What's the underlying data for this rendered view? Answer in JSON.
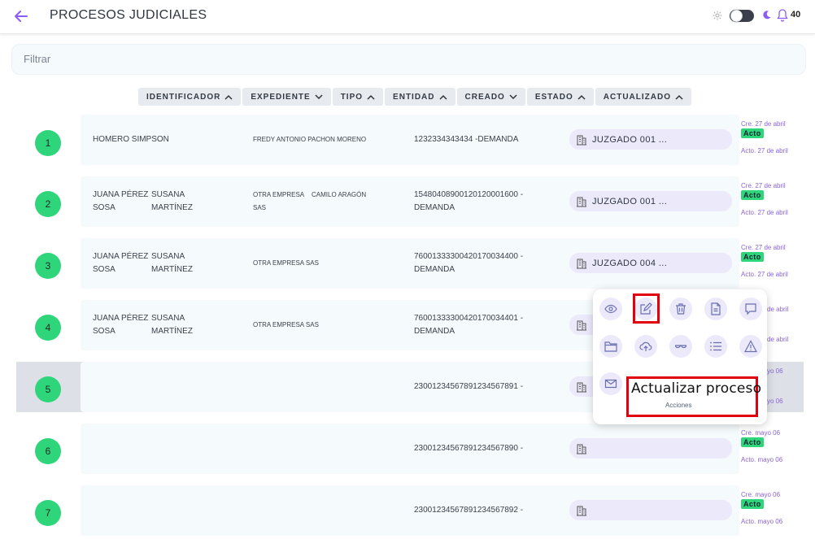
{
  "header": {
    "title": "PROCESOS JUDICIALES",
    "notification_count": "40",
    "accent": "#8b5cf6"
  },
  "filter": {
    "placeholder": "Filtrar"
  },
  "sort_columns": [
    {
      "label": "IDENTIFICADOR",
      "dir": "up"
    },
    {
      "label": "EXPEDIENTE",
      "dir": "down"
    },
    {
      "label": "TIPO",
      "dir": "up"
    },
    {
      "label": "ENTIDAD",
      "dir": "up"
    },
    {
      "label": "CREADO",
      "dir": "down"
    },
    {
      "label": "ESTADO",
      "dir": "up"
    },
    {
      "label": "ACTUALIZADO",
      "dir": "up"
    }
  ],
  "rows": [
    {
      "num": "1",
      "name_a": "HOMERO SIMPSON",
      "name_b": "",
      "name_c": "",
      "name_d": "",
      "exp_a": "FREDY ANTONIO PACHON MORENO",
      "exp_b": "",
      "exp_c": "",
      "id_line1": "1232334343434 -DEMANDA",
      "id_line2": "",
      "entity": "JUZGADO 001 ...",
      "created": "Cre. 27 de abril",
      "status": "Acto",
      "updated": "Acto. 27 de abril"
    },
    {
      "num": "2",
      "name_a": "JUANA PÉREZ",
      "name_b": "SUSANA",
      "name_c": "SOSA",
      "name_d": "MARTÍNEZ",
      "exp_a": "OTRA EMPRESA",
      "exp_b": "CAMILO ARAGÓN",
      "exp_c": "SAS",
      "id_line1": "15480408900120120001600 -",
      "id_line2": "DEMANDA",
      "entity": "JUZGADO 001 ...",
      "created": "Cre. 27 de abril",
      "status": "Acto",
      "updated": "Acto. 27 de abril"
    },
    {
      "num": "3",
      "name_a": "JUANA PÉREZ",
      "name_b": "SUSANA",
      "name_c": "SOSA",
      "name_d": "MARTÍNEZ",
      "exp_a": "OTRA EMPRESA SAS",
      "exp_b": "",
      "exp_c": "",
      "id_line1": "76001333300420170034400 -",
      "id_line2": "DEMANDA",
      "entity": "JUZGADO 004 ...",
      "created": "Cre. 27 de abril",
      "status": "Acto",
      "updated": "Acto. 27 de abril"
    },
    {
      "num": "4",
      "name_a": "JUANA PÉREZ",
      "name_b": "SUSANA",
      "name_c": "SOSA",
      "name_d": "MARTÍNEZ",
      "exp_a": "OTRA EMPRESA SAS",
      "exp_b": "",
      "exp_c": "",
      "id_line1": "76001333300420170034401 -",
      "id_line2": "DEMANDA",
      "entity": "",
      "created": "de abril",
      "status": "",
      "updated": "de abril"
    },
    {
      "num": "5",
      "name_a": "",
      "name_b": "",
      "name_c": "",
      "name_d": "",
      "exp_a": "",
      "exp_b": "",
      "exp_c": "",
      "id_line1": "23001234567891234567891 -",
      "id_line2": "",
      "entity": "",
      "created": "yo 06",
      "status": "",
      "updated": "yo 06"
    },
    {
      "num": "6",
      "name_a": "",
      "name_b": "",
      "name_c": "",
      "name_d": "",
      "exp_a": "",
      "exp_b": "",
      "exp_c": "",
      "id_line1": "23001234567891234567890 -",
      "id_line2": "",
      "entity": "",
      "created": "Cre. mayo 06",
      "status": "Acto",
      "updated": "Acto. mayo 06"
    },
    {
      "num": "7",
      "name_a": "",
      "name_b": "",
      "name_c": "",
      "name_d": "",
      "exp_a": "",
      "exp_b": "",
      "exp_c": "",
      "id_line1": "23001234567891234567892 -",
      "id_line2": "",
      "entity": "",
      "created": "Cre. mayo 06",
      "status": "Acto",
      "updated": "Acto. mayo 06"
    }
  ],
  "actions_popup": {
    "tooltip_title": "Actualizar proceso",
    "tooltip_subtitle": "Acciones",
    "icons": [
      "eye-icon",
      "edit-icon",
      "trash-icon",
      "document-icon",
      "comment-icon",
      "folder-icon",
      "cloud-upload-icon",
      "glasses-icon",
      "list-icon",
      "warning-icon",
      "mail-icon"
    ]
  }
}
